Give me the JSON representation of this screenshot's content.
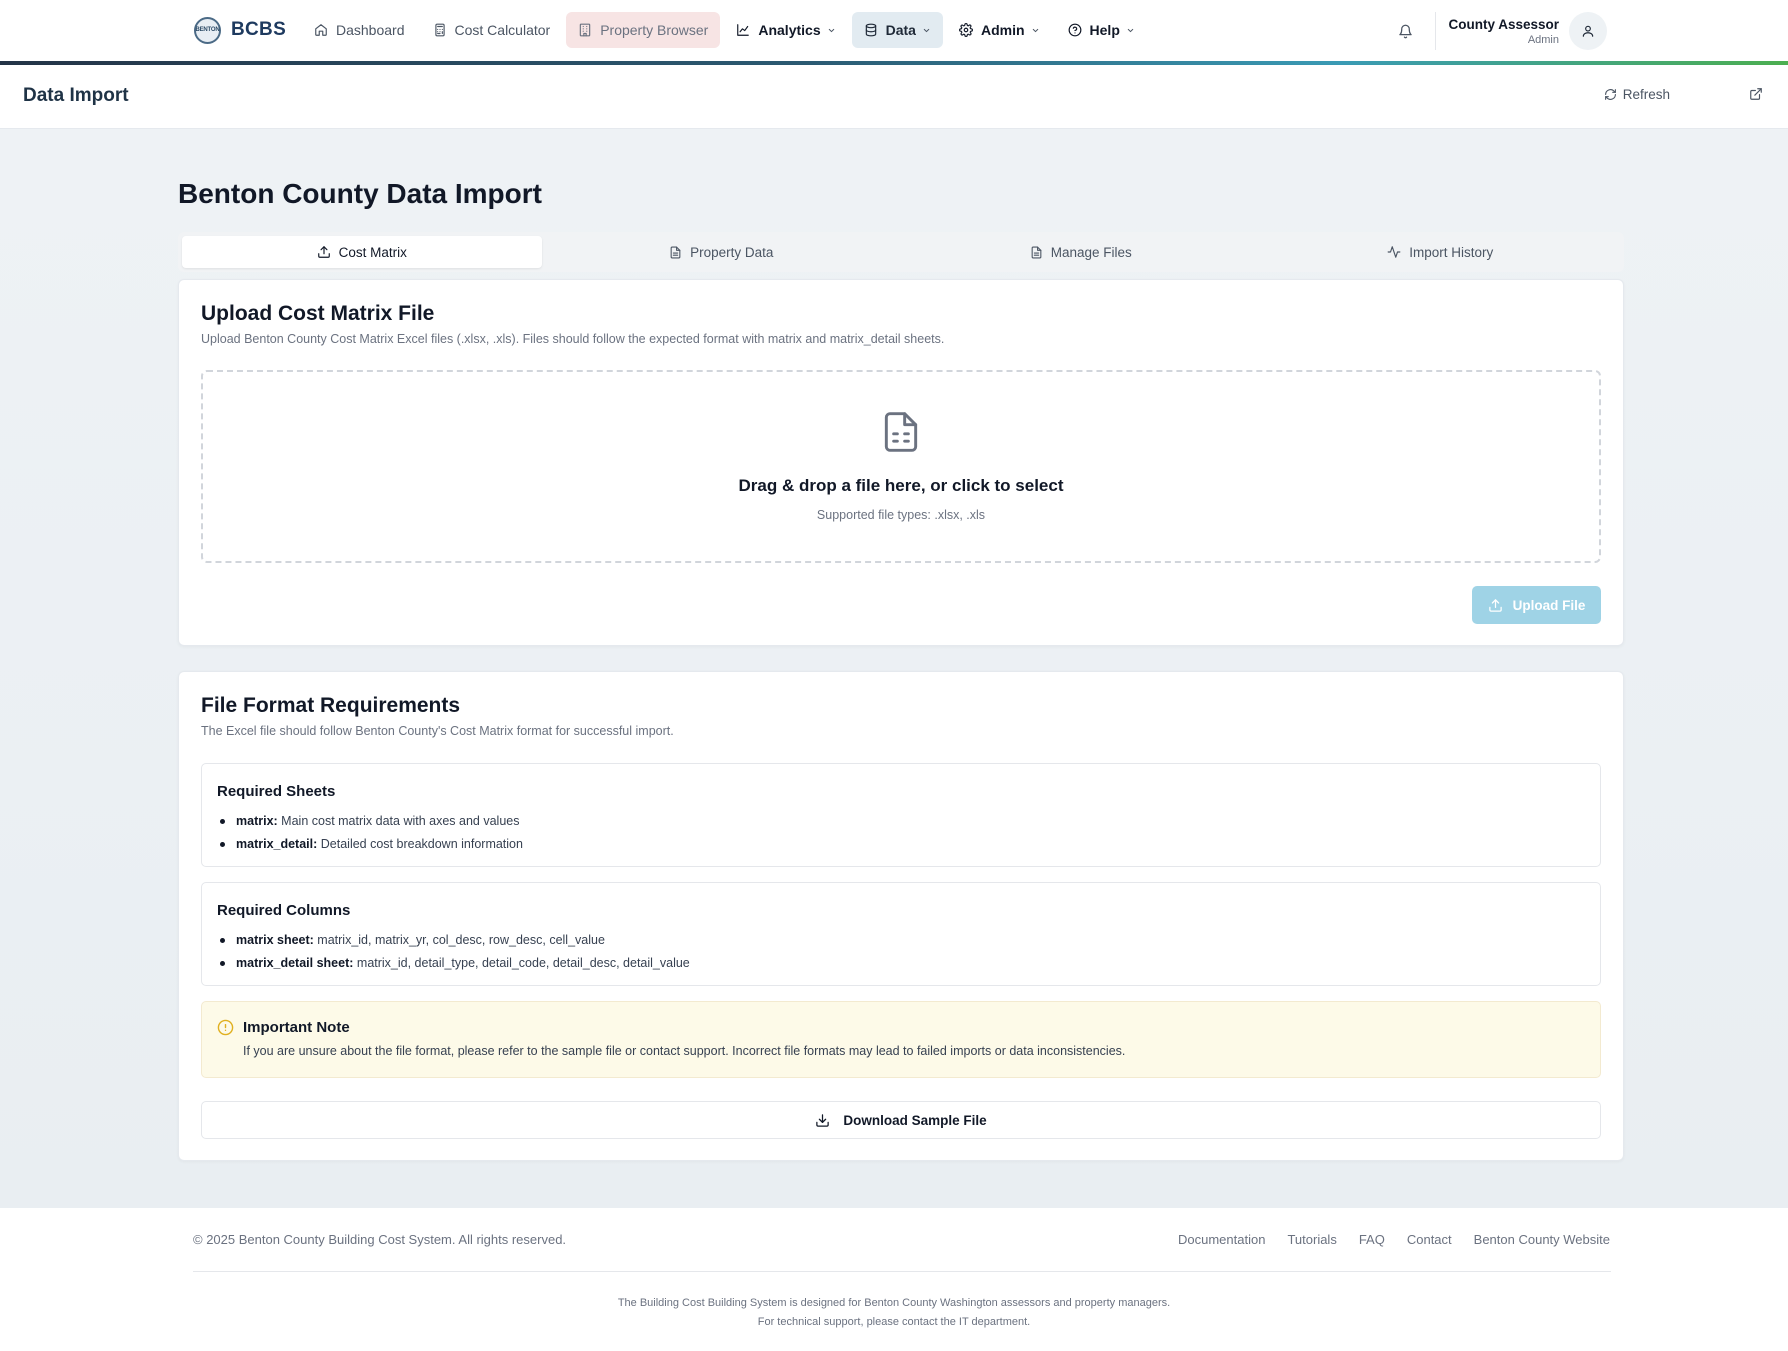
{
  "nav": {
    "brand": "BCBS",
    "brand_logo_text": "BENTON",
    "items": [
      {
        "label": "Dashboard",
        "icon": "home-icon"
      },
      {
        "label": "Cost Calculator",
        "icon": "calculator-icon"
      },
      {
        "label": "Property Browser",
        "icon": "building-icon"
      },
      {
        "label": "Analytics",
        "icon": "line-chart-icon"
      },
      {
        "label": "Data",
        "icon": "database-icon"
      },
      {
        "label": "Admin",
        "icon": "gear-icon"
      },
      {
        "label": "Help",
        "icon": "help-circle-icon"
      }
    ],
    "user_name": "County Assessor",
    "user_role": "Admin"
  },
  "page_header": {
    "title": "Data Import",
    "refresh_label": "Refresh"
  },
  "main": {
    "heading": "Benton County Data Import",
    "tabs": [
      {
        "label": "Cost Matrix",
        "active": true
      },
      {
        "label": "Property Data",
        "active": false
      },
      {
        "label": "Manage Files",
        "active": false
      },
      {
        "label": "Import History",
        "active": false
      }
    ]
  },
  "upload_card": {
    "title": "Upload Cost Matrix File",
    "description": "Upload Benton County Cost Matrix Excel files (.xlsx, .xls). Files should follow the expected format with matrix and matrix_detail sheets.",
    "dropzone_title": "Drag & drop a file here, or click to select",
    "dropzone_sub": "Supported file types: .xlsx, .xls",
    "upload_button": "Upload File"
  },
  "format_card": {
    "title": "File Format Requirements",
    "description": "The Excel file should follow Benton County's Cost Matrix format for successful import.",
    "sheets_title": "Required Sheets",
    "sheets": [
      {
        "name": "matrix:",
        "desc": "Main cost matrix data with axes and values"
      },
      {
        "name": "matrix_detail:",
        "desc": "Detailed cost breakdown information"
      }
    ],
    "columns_title": "Required Columns",
    "columns": [
      {
        "name": "matrix sheet:",
        "desc": "matrix_id, matrix_yr, col_desc, row_desc, cell_value"
      },
      {
        "name": "matrix_detail sheet:",
        "desc": "matrix_id, detail_type, detail_code, detail_desc, detail_value"
      }
    ],
    "note_title": "Important Note",
    "note_text": "If you are unsure about the file format, please refer to the sample file or contact support. Incorrect file formats may lead to failed imports or data inconsistencies.",
    "download_button": "Download Sample File"
  },
  "footer": {
    "copyright": "© 2025 Benton County Building Cost System. All rights reserved.",
    "links": [
      "Documentation",
      "Tutorials",
      "FAQ",
      "Contact",
      "Benton County Website"
    ],
    "note_line1": "The Building Cost Building System is designed for Benton County Washington assessors and property managers.",
    "note_line2": "For technical support, please contact the IT department."
  },
  "colors": {
    "accent_upload": "#9fd3e6",
    "note_bg": "#fdfae8",
    "note_icon": "#e0b020"
  }
}
